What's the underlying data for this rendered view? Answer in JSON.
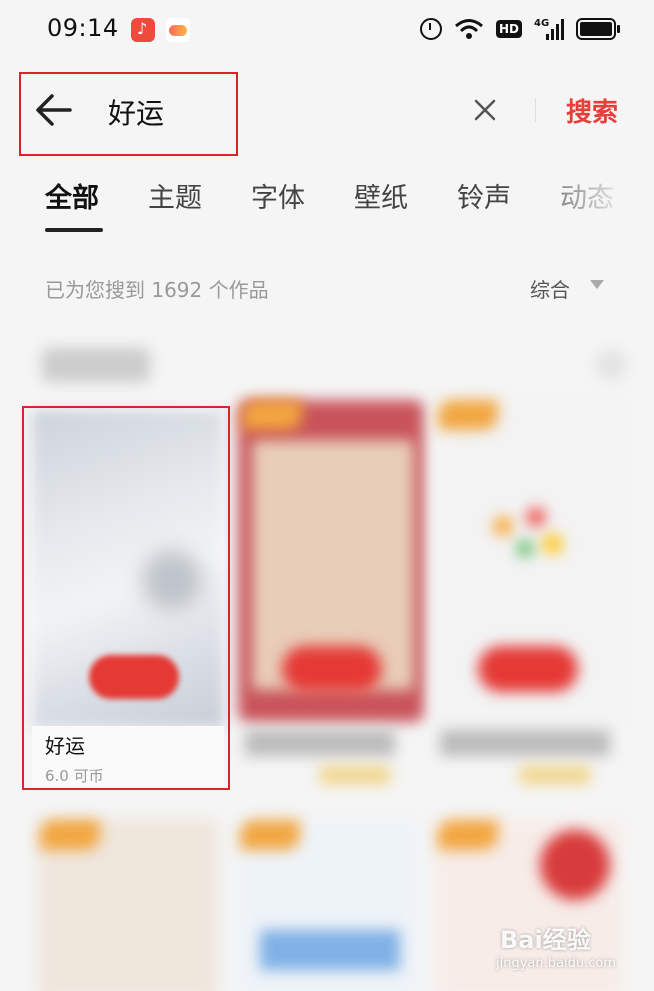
{
  "status_bar": {
    "time": "09:14",
    "network": "4G",
    "hd_label": "HD",
    "icons": [
      "music-app-icon",
      "game-app-icon",
      "alarm-icon",
      "wifi-icon",
      "hd-icon",
      "signal-icon",
      "battery-icon"
    ]
  },
  "search": {
    "query": "好运",
    "button_label": "搜索"
  },
  "tabs": [
    {
      "label": "全部",
      "active": true
    },
    {
      "label": "主题",
      "active": false
    },
    {
      "label": "字体",
      "active": false
    },
    {
      "label": "壁纸",
      "active": false
    },
    {
      "label": "铃声",
      "active": false
    },
    {
      "label": "动态",
      "active": false
    }
  ],
  "results": {
    "count_text": "已为您搜到 1692 个作品",
    "sort_label": "综合"
  },
  "featured_item": {
    "title": "好运",
    "price": "6.0 可币"
  },
  "watermark": {
    "brand": "Bai经验",
    "url": "jingyan.baidu.com"
  },
  "colors": {
    "accent": "#e83e3a",
    "highlight_box": "#d9242b",
    "background": "#f5f5f5"
  }
}
